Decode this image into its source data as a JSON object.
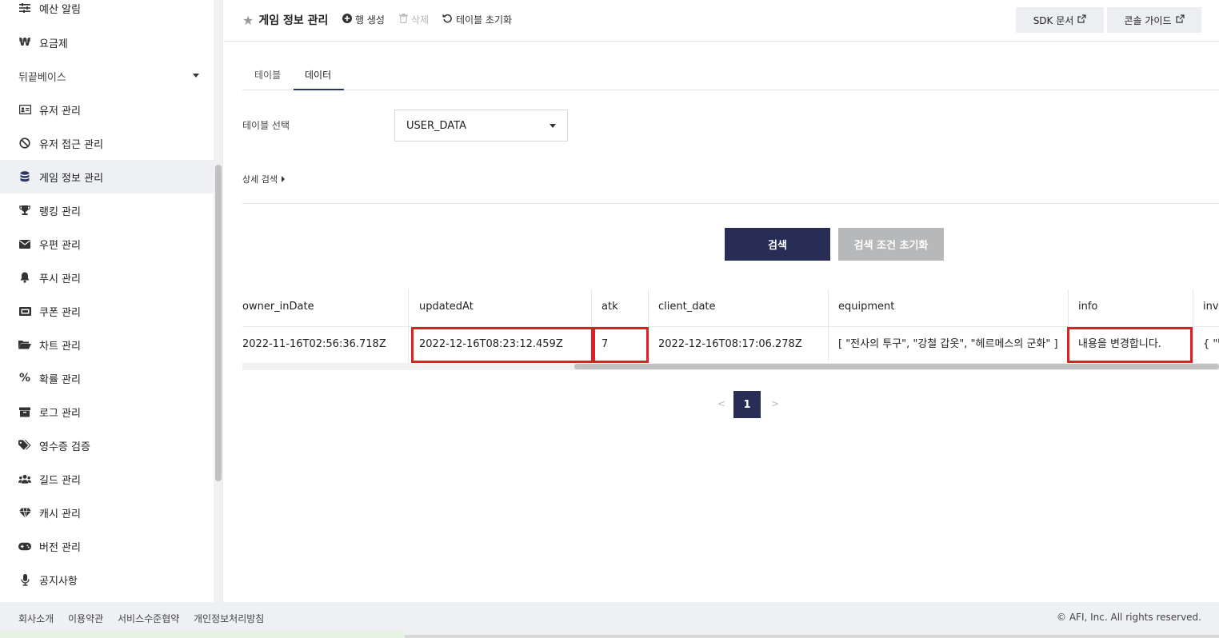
{
  "sidebar": {
    "items": [
      {
        "label": "예산 알림",
        "icon": "sliders-icon"
      },
      {
        "label": "요금제",
        "icon": "won-icon"
      },
      {
        "label": "뒤끝베이스",
        "icon": "caret-down-icon"
      },
      {
        "label": "유저 관리",
        "icon": "id-card-icon"
      },
      {
        "label": "유저 접근 관리",
        "icon": "ban-icon"
      },
      {
        "label": "게임 정보 관리",
        "icon": "database-icon"
      },
      {
        "label": "랭킹 관리",
        "icon": "trophy-icon"
      },
      {
        "label": "우편 관리",
        "icon": "envelope-icon"
      },
      {
        "label": "푸시 관리",
        "icon": "bell-icon"
      },
      {
        "label": "쿠폰 관리",
        "icon": "ticket-icon"
      },
      {
        "label": "차트 관리",
        "icon": "folder-open-icon"
      },
      {
        "label": "확률 관리",
        "icon": "percent-icon"
      },
      {
        "label": "로그 관리",
        "icon": "archive-icon"
      },
      {
        "label": "영수증 검증",
        "icon": "tags-icon"
      },
      {
        "label": "길드 관리",
        "icon": "users-icon"
      },
      {
        "label": "캐시 관리",
        "icon": "gem-icon"
      },
      {
        "label": "버전 관리",
        "icon": "gamepad-icon"
      },
      {
        "label": "공지사항",
        "icon": "microphone-icon"
      }
    ]
  },
  "header": {
    "title": "게임 정보 관리",
    "actions": {
      "create_row": "행 생성",
      "delete": "삭제",
      "reset_table": "테이블 초기화"
    },
    "sdk_doc": "SDK 문서",
    "console_guide": "콘솔 가이드"
  },
  "tabs": [
    {
      "label": "테이블",
      "active": false
    },
    {
      "label": "데이터",
      "active": true
    }
  ],
  "table_select": {
    "label": "테이블 선택",
    "value": "USER_DATA"
  },
  "advanced_search": "상세 검색",
  "buttons": {
    "search": "검색",
    "reset_conditions": "검색 조건 초기화"
  },
  "grid": {
    "columns": [
      "owner_inDate",
      "updatedAt",
      "atk",
      "client_date",
      "equipment",
      "info",
      "inventory"
    ],
    "rows": [
      [
        "2022-11-16T02:56:36.718Z",
        "2022-12-16T08:23:12.459Z",
        "7",
        "2022-12-16T08:17:06.278Z",
        "[ \"전사의 투구\", \"강철 갑옷\", \"헤르메스의 군화\" ]",
        "내용을 변경합니다.",
        "{ \"빨"
      ]
    ]
  },
  "pagination": {
    "prev": "<",
    "current": "1",
    "next": ">"
  },
  "footer": {
    "links": [
      "회사소개",
      "이용약관",
      "서비스수준협약",
      "개인정보처리방침"
    ],
    "copyright": "© AFI, Inc. All rights reserved."
  },
  "colors": {
    "primary": "#272d55",
    "highlight": "#e01e26",
    "disabled_button": "#b7b8ba"
  }
}
